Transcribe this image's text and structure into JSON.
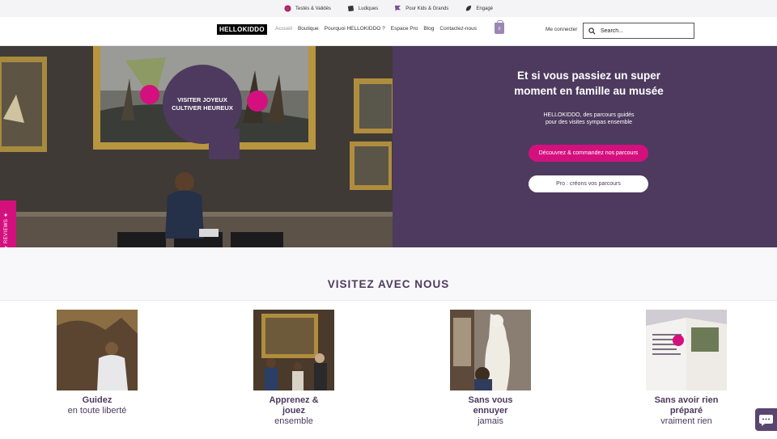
{
  "topbar": {
    "items": [
      {
        "label": "Testés & Validés",
        "icon": "heart-icon",
        "color": "#c2185b"
      },
      {
        "label": "Ludiques",
        "icon": "puzzle-icon",
        "color": "#333333"
      },
      {
        "label": "Pour Kids & Grands",
        "icon": "flag-icon",
        "color": "#7b4f9a"
      },
      {
        "label": "Engagé",
        "icon": "leaf-icon",
        "color": "#333333"
      }
    ]
  },
  "header": {
    "logo": "HELLOKIDDO",
    "nav": [
      "Accueil",
      "Boutique",
      "Pourquoi HELLOKIDDO ?",
      "Espace Pro",
      "Blog",
      "Contactez-nous"
    ],
    "cart_count": "0",
    "login": "Me connecter",
    "search_placeholder": "Search..."
  },
  "hero": {
    "badge_line1": "VISITER JOYEUX",
    "badge_line2": "CULTIVER HEUREUX",
    "title_line1": "Et si vous passiez un super",
    "title_line2": "moment en famille au musée",
    "sub_line1": "HELLOKIDDO, des parcours guidés",
    "sub_line2": "pour des visites sympas ensemble",
    "cta_primary": "Découvrez & commandez nos parcours",
    "cta_secondary": "Pro : créons vos parcours"
  },
  "reviews_tab": "★ REVIEWS ★",
  "section": {
    "title": "VISITEZ AVEC NOUS",
    "cards": [
      {
        "title": "Guidez",
        "sub": "en toute liberté"
      },
      {
        "title_l1": "Apprenez &",
        "title_l2": "jouez",
        "sub": "ensemble"
      },
      {
        "title_l1": "Sans vous",
        "title_l2": "ennuyer",
        "sub": "jamais"
      },
      {
        "title_l1": "Sans avoir rien",
        "title_l2": "préparé",
        "sub": "vraiment rien"
      }
    ]
  },
  "colors": {
    "brand_purple": "#4d3a5e",
    "brand_pink": "#d4107f"
  }
}
